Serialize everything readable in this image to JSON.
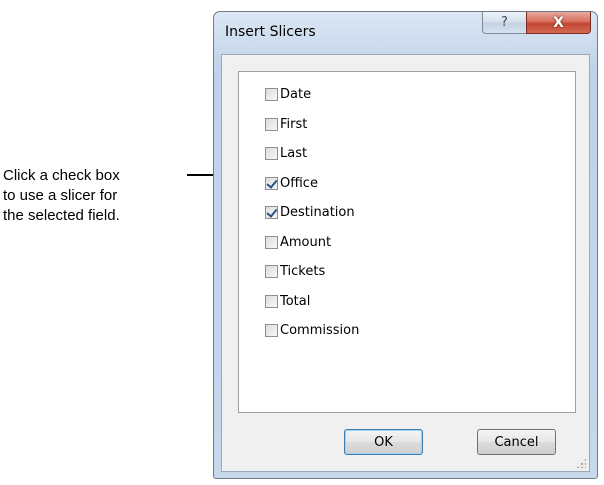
{
  "callout": {
    "lines": [
      "Click a check box",
      "to use a slicer for",
      "the selected field."
    ]
  },
  "dialog": {
    "title": "Insert Slicers",
    "help_glyph": "?",
    "close_glyph": "X",
    "fields": [
      {
        "label": "Date",
        "checked": false
      },
      {
        "label": "First",
        "checked": false
      },
      {
        "label": "Last",
        "checked": false
      },
      {
        "label": "Office",
        "checked": true
      },
      {
        "label": "Destination",
        "checked": true
      },
      {
        "label": "Amount",
        "checked": false
      },
      {
        "label": "Tickets",
        "checked": false
      },
      {
        "label": "Total",
        "checked": false
      },
      {
        "label": "Commission",
        "checked": false
      }
    ],
    "ok_label": "OK",
    "cancel_label": "Cancel"
  }
}
